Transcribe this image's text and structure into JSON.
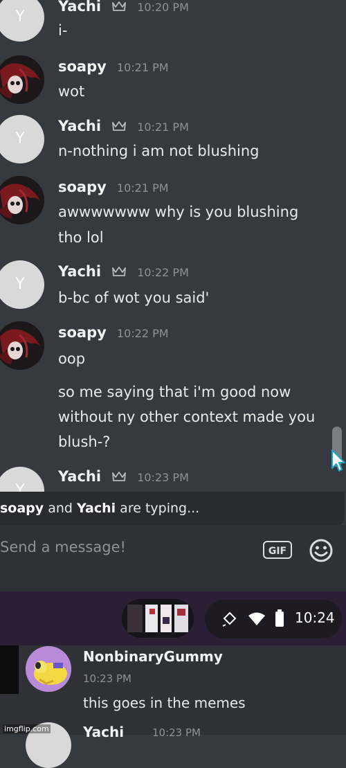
{
  "messages": [
    {
      "user": "Yachi",
      "time": "10:20 PM",
      "lines": [
        "i-"
      ]
    },
    {
      "user": "soapy",
      "time": "10:21 PM",
      "lines": [
        "wot"
      ]
    },
    {
      "user": "Yachi",
      "time": "10:21 PM",
      "lines": [
        "n-nothing i am not blushing"
      ]
    },
    {
      "user": "soapy",
      "time": "10:21 PM",
      "lines": [
        "awwwwwww why is you blushing",
        "tho lol"
      ]
    },
    {
      "user": "Yachi",
      "time": "10:22 PM",
      "lines": [
        "b-bc of wot you said'"
      ]
    },
    {
      "user": "soapy",
      "time": "10:22 PM",
      "lines": [
        "oop",
        "so me saying that i'm good now",
        "without ny other context made you",
        "blush-?"
      ]
    },
    {
      "user": "Yachi",
      "time": "10:23 PM",
      "lines": []
    }
  ],
  "avatar_letter": "Y",
  "typing": {
    "user1": "soapy",
    "and": " and ",
    "user2": "Yachi",
    "suffix": " are typing..."
  },
  "composer": {
    "placeholder": "Send a message!",
    "gif_label": "GIF"
  },
  "statusbar": {
    "time": "10:24"
  },
  "bottom_message": {
    "user": "NonbinaryGummy",
    "time": "10:23 PM",
    "text": "this goes in the memes"
  },
  "bottom_next": {
    "user": "Yachi",
    "time": "10:23 PM"
  },
  "watermark": "imgflip.com",
  "colors": {
    "background": "#36393f",
    "composer": "#2f3136",
    "statusbar": "#2c1f35"
  }
}
